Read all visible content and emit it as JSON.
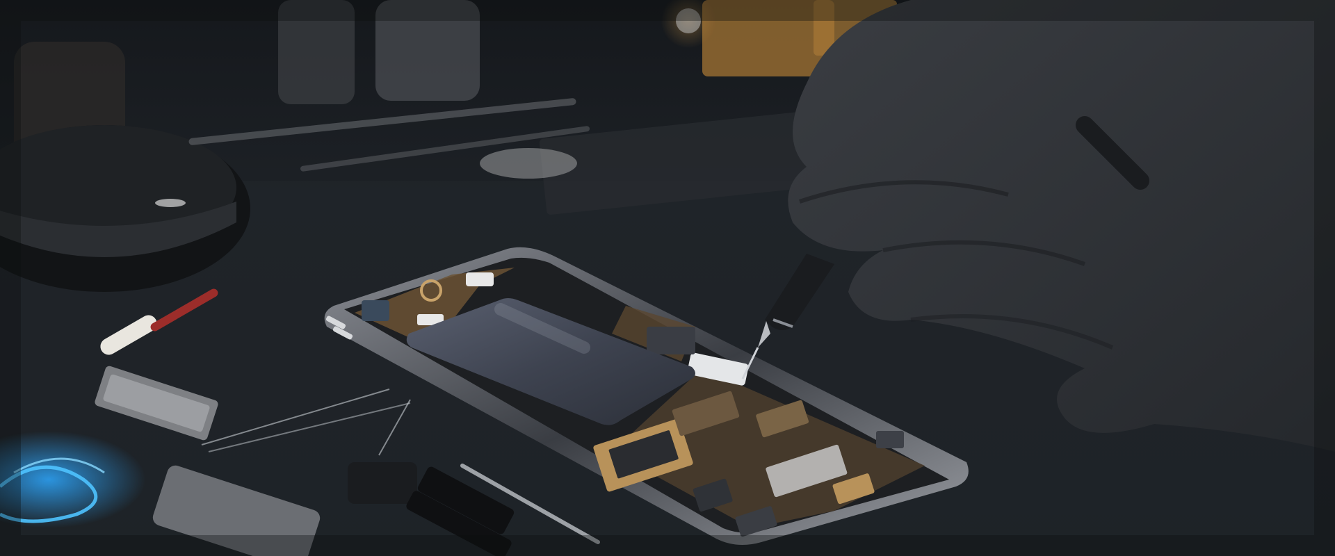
{
  "image": {
    "subject": "",
    "colors": {
      "background": "#1a1d21",
      "table": "#23272c",
      "phone_frame": "#2b2e33",
      "battery": "#3a3f4a",
      "circuit_gold": "#b8925a",
      "glove": "#2f3236",
      "blue_glow": "#2ea8ff",
      "warm_light": "#e0a040"
    }
  }
}
